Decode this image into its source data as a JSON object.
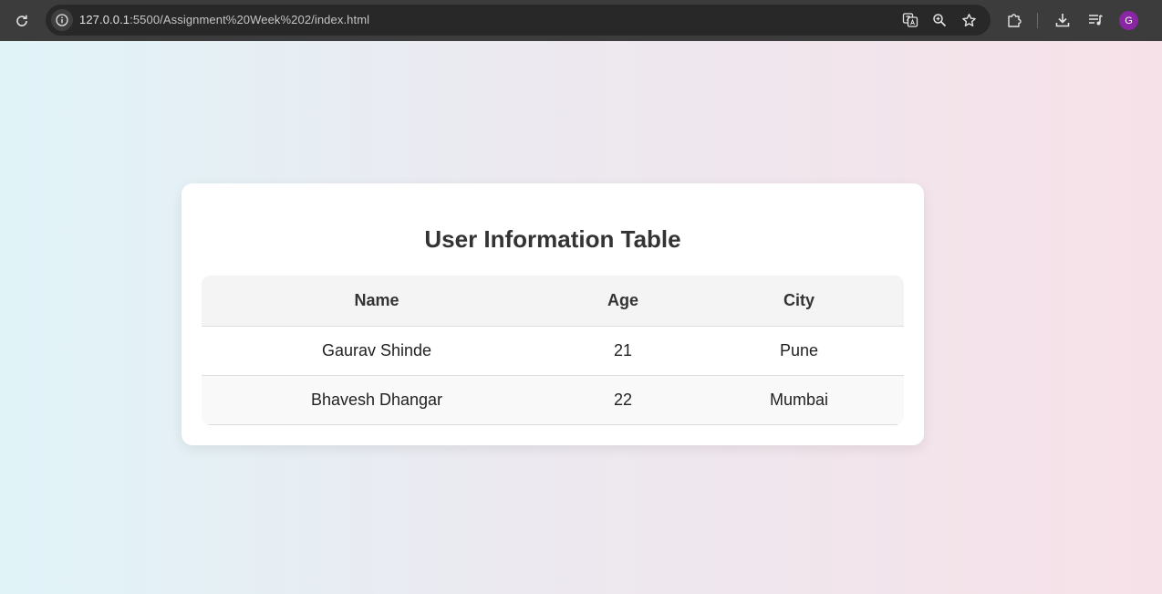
{
  "browser": {
    "url_host": "127.0.0.1",
    "url_rest": ":5500/Assignment%20Week%202/index.html",
    "profile_initial": "G",
    "icons": [
      "reload-icon",
      "site-info-icon",
      "translate-icon",
      "zoom-icon",
      "bookmark-star-icon",
      "extensions-icon",
      "download-icon",
      "media-control-icon"
    ],
    "avatar_color": "#8a26a6"
  },
  "page": {
    "title": "User Information Table",
    "table": {
      "headers": [
        "Name",
        "Age",
        "City"
      ],
      "rows": [
        [
          "Gaurav Shinde",
          "21",
          "Pune"
        ],
        [
          "Bhavesh Dhangar",
          "22",
          "Mumbai"
        ]
      ]
    },
    "colors": {
      "gradient_left": "#e0f4f8",
      "gradient_right": "#f7e1e8",
      "header_bg": "#f4f4f4",
      "title_color": "#333333"
    }
  }
}
